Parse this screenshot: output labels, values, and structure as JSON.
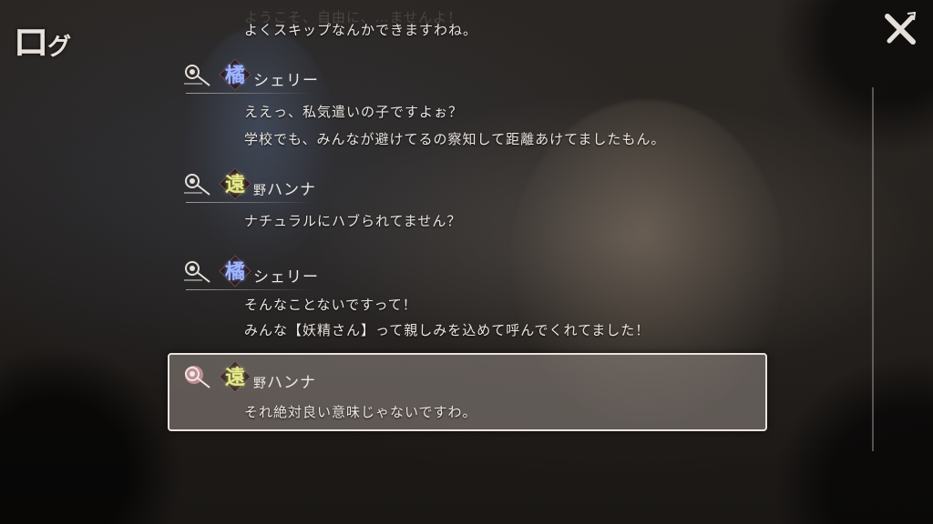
{
  "header": {
    "title_main": "ロ",
    "title_small": "グ",
    "close_icon": "close-x-icon"
  },
  "faded_top_line": "ようこそ、自由に、…ませんよ！",
  "previous_tail": "よくスキップなんかできますわね。",
  "entries": [
    {
      "emblem_kanji": "橘",
      "emblem_color": "#9fb6ff",
      "speaker": "シェリー",
      "lines": [
        "ええっ、私気遣いの子ですよぉ？",
        "学校でも、みんなが避けてるの察知して距離あけてましたもん。"
      ]
    },
    {
      "emblem_kanji": "遠",
      "emblem_color": "#e7ea8a",
      "speaker_prefix": "野",
      "speaker": "ハンナ",
      "lines": [
        "ナチュラルにハブられてません？"
      ]
    },
    {
      "emblem_kanji": "橘",
      "emblem_color": "#9fb6ff",
      "speaker": "シェリー",
      "lines": [
        "そんなことないですって！",
        "みんな【妖精さん】って親しみを込めて呼んでくれてました！"
      ]
    },
    {
      "emblem_kanji": "遠",
      "emblem_color": "#e7ea8a",
      "speaker_prefix": "野",
      "speaker": "ハンナ",
      "lines": [
        "それ絶対良い意味じゃないですわ。"
      ],
      "selected": true
    }
  ]
}
